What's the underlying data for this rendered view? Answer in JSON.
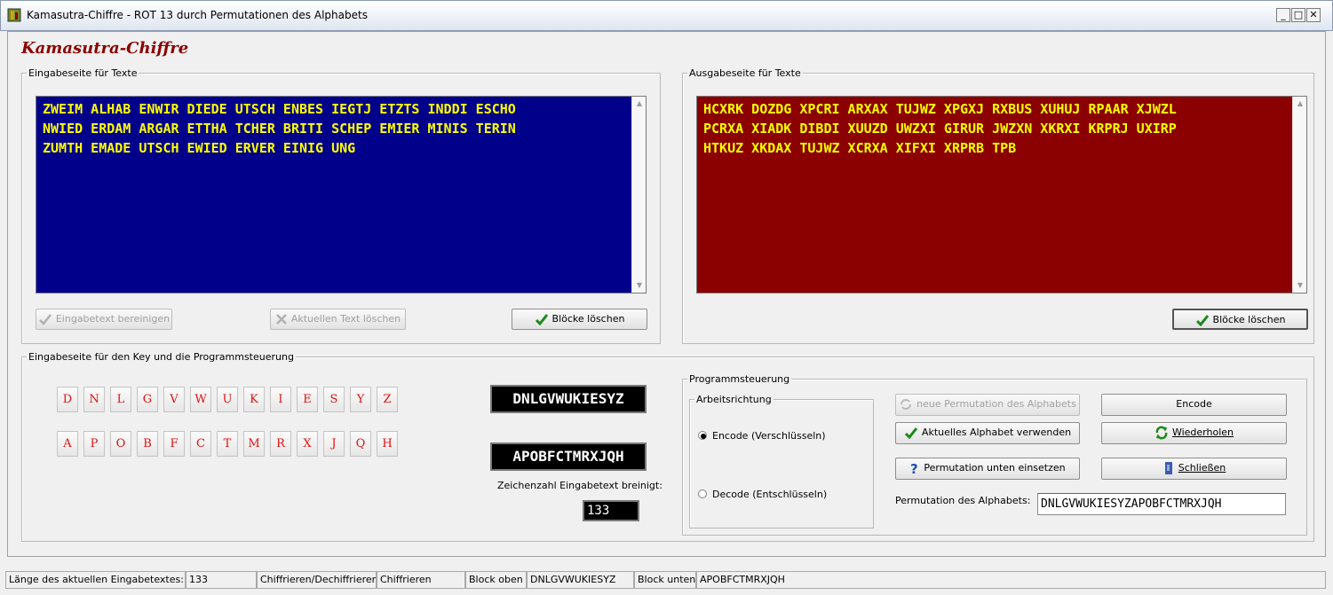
{
  "window": {
    "title": "Kamasutra-Chiffre - ROT 13 durch Permutationen des Alphabets"
  },
  "heading": "Kamasutra-Chiffre",
  "input_group": {
    "label": "Eingabeseite für Texte",
    "text": "ZWEIM ALHAB ENWIR DIEDE UTSCH ENBES IEGTJ ETZTS INDDI ESCHO\nNWIED ERDAM ARGAR ETTHA TCHER BRITI SCHEP EMIER MINIS TERIN\nZUMTH EMADE UTSCH EWIED ERVER EINIG UNG",
    "buttons": {
      "clean": "Eingabetext bereinigen",
      "delete": "Aktuellen Text löschen",
      "blocks": "Blöcke löschen"
    }
  },
  "output_group": {
    "label": "Ausgabeseite für Texte",
    "text": "HCXRK DOZDG XPCRI ARXAX TUJWZ XPGXJ RXBUS XUHUJ RPAAR XJWZL\nPCRXA XIADK DIBDI XUUZD UWZXI GIRUR JWZXN XKRXI KRPRJ UXIRP\nHTKUZ XKDAX TUJWZ XCRXA XIFXI XRPRB TPB",
    "buttons": {
      "blocks": "Blöcke löschen"
    }
  },
  "key_group": {
    "label": "Eingabeseite für den Key und die Programmsteuerung",
    "top_row": [
      "D",
      "N",
      "L",
      "G",
      "V",
      "W",
      "U",
      "K",
      "I",
      "E",
      "S",
      "Y",
      "Z"
    ],
    "bottom_row": [
      "A",
      "P",
      "O",
      "B",
      "F",
      "C",
      "T",
      "M",
      "R",
      "X",
      "J",
      "Q",
      "H"
    ],
    "top_display": "DNLGVWUKIESYZ",
    "bottom_display": "APOBFCTMRXJQH",
    "count_label": "Zeichenzahl Eingabetext breinigt:",
    "count_value": "133"
  },
  "control_group": {
    "label": "Programmsteuerung",
    "direction_label": "Arbeitsrichtung",
    "encode_option": "Encode (Verschlüsseln)",
    "decode_option": "Decode (Entschlüsseln)",
    "selected": "encode",
    "buttons": {
      "new_perm": "neue Permutation des Alphabets",
      "use_alpha": "Aktuelles Alphabet verwenden",
      "insert_perm": "Permutation unten einsetzen",
      "encode": "Encode",
      "repeat": "Wiederholen",
      "close": "Schließen"
    },
    "perm_label": "Permutation des Alphabets:",
    "perm_value": "DNLGVWUKIESYZAPOBFCTMRXJQH"
  },
  "statusbar": {
    "length_label": "Länge des aktuellen Eingabetextes:",
    "length_value": "133",
    "mode_label": "Chiffrieren/Dechiffrieren",
    "mode_value": "Chiffrieren",
    "top_label": "Block oben",
    "top_value": "DNLGVWUKIESYZ",
    "bottom_label": "Block unten",
    "bottom_value": "APOBFCTMRXJQH"
  },
  "colors": {
    "input_bg": "#00008b",
    "output_bg": "#8b0000",
    "text_fg": "#ffff00",
    "key_letter": "#e01010",
    "heading": "#8b0000"
  }
}
